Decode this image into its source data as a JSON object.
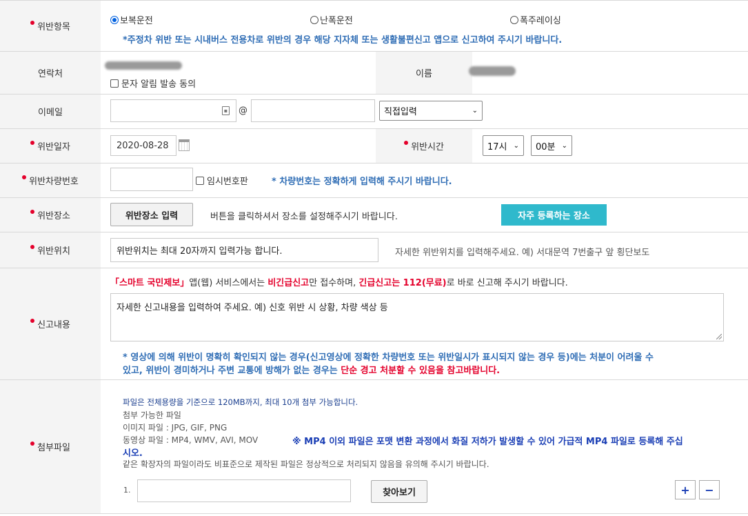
{
  "violation_type": {
    "label": "위반항목",
    "options": [
      "보복운전",
      "난폭운전",
      "폭주레이싱"
    ],
    "selected": "보복운전",
    "notice": "*주정차 위반 또는 시내버스 전용차로 위반의 경우 해당 지자체 또는 생활불편신고 앱으로 신고하여 주시기 바랍니다."
  },
  "contact": {
    "label": "연락처",
    "sms_consent_label": "문자 알림 발송 동의",
    "name_label": "이름"
  },
  "email": {
    "label": "이메일",
    "local_value": "",
    "at": "@",
    "domain_value": "",
    "domain_select": "직접입력"
  },
  "date": {
    "label": "위반일자",
    "value": "2020-08-28",
    "time_label": "위반시간",
    "hour": "17시",
    "minute": "00분"
  },
  "plate": {
    "label": "위반차량번호",
    "value": "",
    "temp_label": "임시번호판",
    "notice": "* 차량번호는 정확하게 입력해 주시기 바랍니다."
  },
  "location": {
    "label": "위반장소",
    "input_button": "위반장소 입력",
    "help": "버튼을 클릭하셔서 장소를 설정해주시기 바랍니다.",
    "favorites_button": "자주 등록하는 장소"
  },
  "position": {
    "label": "위반위치",
    "placeholder": "위반위치는 최대 20자까지 입력가능 합니다.",
    "help": "자세한 위반위치를 입력해주세요. 예) 서대문역 7번출구 앞 횡단보도"
  },
  "report": {
    "label": "신고내용",
    "notice_parts": [
      "「스마트 국민제보」",
      "앱(웹) 서비스에서는 ",
      "비긴급신고",
      "만 접수하며, ",
      "긴급신고는 112(무료)",
      "로 바로 신고해 주시기 바랍니다."
    ],
    "placeholder": "자세한 신고내용을 입력하여 주세요. 예) 신호 위반 시 상황, 차량 색상 등",
    "warning_line1": "* 영상에 의해 위반이 명확히 확인되지 않는 경우(신고영상에 정확한 차량번호 또는 위반일시가 표시되지 않는 경우 등)에는 처분이 어려울 수",
    "warning_line2_a": "있고, 위반이 경미하거나 주변 교통에 방해가 없는 경우는 ",
    "warning_line2_b": "단순 경고 처분할 수 있음을 참고바랍니다."
  },
  "attachment": {
    "label": "첨부파일",
    "line1": "파일은 전체용량을 기준으로 120MB까지, 최대 10개 첨부 가능합니다.",
    "line2": "첨부 가능한 파일",
    "line3": "이미지 파일 : JPG, GIF, PNG",
    "line4": "동영상 파일 : MP4, WMV, AVI, MOV",
    "line4_note": "※ MP4 이외 파일은 포맷 변환 과정에서 화질 저하가 발생할 수 있어 가급적 MP4 파일로 등록해 주십",
    "line4_note_cont": "시오.",
    "line5": "같은 확장자의 파일이라도 비표준으로 제작된 파일은 정상적으로 처리되지 않음을 유의해 주시기 바랍니다.",
    "item_index": "1.",
    "browse_button": "찾아보기",
    "add": "+",
    "remove": "−"
  },
  "colors": {
    "required_dot": "#e4002b",
    "notice_blue": "#2f6db5",
    "favorites_button_bg": "#2fb9cc",
    "label_bg": "#f4f4f4"
  }
}
